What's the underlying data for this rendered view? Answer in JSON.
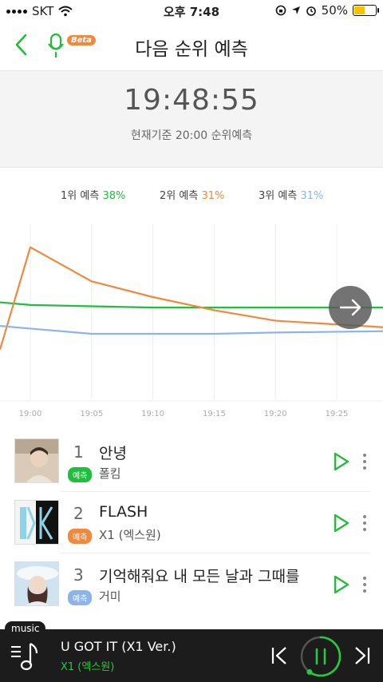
{
  "status_bar": {
    "carrier": "SKT",
    "time": "오후 7:48",
    "battery": "50%",
    "battery_level": 0.5
  },
  "nav": {
    "title": "다음 순위 예측",
    "beta_label": "Beta"
  },
  "clock": {
    "time": "19:48:55",
    "basis_text": "현재기준 20:00 순위예측"
  },
  "legend": [
    {
      "label": "1위 예측",
      "pct": "38%",
      "color": "#1fbf3b"
    },
    {
      "label": "2위 예측",
      "pct": "31%",
      "color": "#f0893b"
    },
    {
      "label": "3위 예측",
      "pct": "31%",
      "color": "#8ab4ea"
    }
  ],
  "chart_data": {
    "type": "line",
    "x": [
      "19:00",
      "19:05",
      "19:10",
      "19:15",
      "19:20",
      "19:25"
    ],
    "series": [
      {
        "color": "#1fbf3b",
        "values": [
          [
            0,
            40
          ],
          [
            1,
            39
          ],
          [
            2,
            38.5
          ],
          [
            3,
            38
          ],
          [
            4,
            38
          ],
          [
            5,
            38
          ],
          [
            6,
            38
          ]
        ]
      },
      {
        "color": "#f0893b",
        "values": [
          [
            0,
            22
          ],
          [
            1,
            61
          ],
          [
            2,
            48
          ],
          [
            3,
            42
          ],
          [
            4,
            37
          ],
          [
            5,
            33
          ],
          [
            6,
            30.5
          ]
        ]
      },
      {
        "color": "#8ab4ea",
        "values": [
          [
            0,
            31
          ],
          [
            1,
            30
          ],
          [
            2,
            28
          ],
          [
            3,
            28
          ],
          [
            4,
            28
          ],
          [
            5,
            28.5
          ],
          [
            6,
            29
          ]
        ]
      }
    ]
  },
  "songs": [
    {
      "rank": "1",
      "title": "안녕",
      "artist": "폴킴",
      "badge": "예측",
      "badge_color": "#1fbf3b"
    },
    {
      "rank": "2",
      "title": "FLASH",
      "artist": "X1 (엑스원)",
      "badge": "예측",
      "badge_color": "#f0893b"
    },
    {
      "rank": "3",
      "title": "기억해줘요 내 모든 날과 그때를",
      "artist": "거미",
      "badge": "예측",
      "badge_color": "#8ab4ea"
    }
  ],
  "player": {
    "tag": "music",
    "track": "U GOT IT (X1 Ver.)",
    "artist": "X1 (엑스원)",
    "progress": 0.6,
    "accent": "#27c940"
  },
  "icons": {
    "back": "chevron-left-icon",
    "mic": "microphone-icon",
    "next_arrow": "arrow-right-icon",
    "play": "play-icon",
    "more": "more-vertical-icon",
    "prev": "skip-previous-icon",
    "pause": "pause-icon",
    "skip": "skip-next-icon"
  }
}
